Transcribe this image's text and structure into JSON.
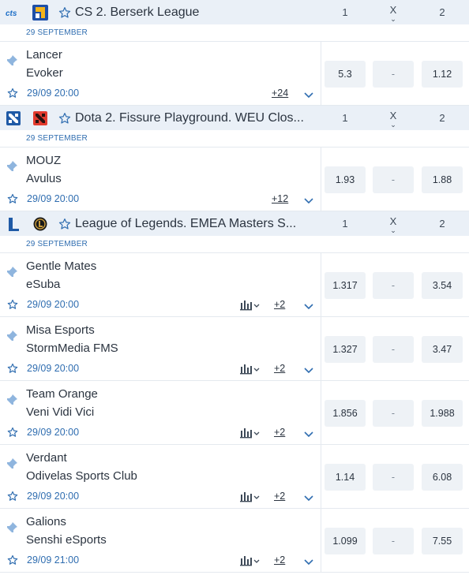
{
  "columns": {
    "home": "1",
    "draw": "X",
    "away": "2"
  },
  "colors": {
    "accent": "#2f6db0",
    "header_bg": "#eaf0f7",
    "odd_bg": "#eef2f6"
  },
  "leagues": [
    {
      "name": "CS 2. Berserk League",
      "sport_icon": "counter-strike-logo",
      "logo_icon": "berserk-league-logo",
      "date": "29 SEPTEMBER",
      "matches": [
        {
          "team1": "Lancer",
          "team2": "Evoker",
          "time": "29/09 20:00",
          "more": "+24",
          "odd1": "5.3",
          "oddx": "-",
          "odd2": "1.12"
        }
      ]
    },
    {
      "name": "Dota 2. Fissure Playground. WEU Clos...",
      "sport_icon": "dota2-logo",
      "logo_icon": "fissure-playground-logo",
      "date": "29 SEPTEMBER",
      "matches": [
        {
          "team1": "MOUZ",
          "team2": "Avulus",
          "time": "29/09 20:00",
          "more": "+12",
          "odd1": "1.93",
          "oddx": "-",
          "odd2": "1.88"
        }
      ]
    },
    {
      "name": "League of Legends. EMEA Masters S...",
      "sport_icon": "league-of-legends-logo",
      "logo_icon": "emea-masters-logo",
      "date": "29 SEPTEMBER",
      "matches": [
        {
          "team1": "Gentle Mates",
          "team2": "eSuba",
          "time": "29/09 20:00",
          "more": "+2",
          "odd1": "1.317",
          "oddx": "-",
          "odd2": "3.54"
        },
        {
          "team1": "Misa Esports",
          "team2": "StormMedia FMS",
          "time": "29/09 20:00",
          "more": "+2",
          "odd1": "1.327",
          "oddx": "-",
          "odd2": "3.47"
        },
        {
          "team1": "Team Orange",
          "team2": "Veni Vidi Vici",
          "time": "29/09 20:00",
          "more": "+2",
          "odd1": "1.856",
          "oddx": "-",
          "odd2": "1.988"
        },
        {
          "team1": "Verdant",
          "team2": "Odivelas Sports Club",
          "time": "29/09 20:00",
          "more": "+2",
          "odd1": "1.14",
          "oddx": "-",
          "odd2": "6.08"
        },
        {
          "team1": "Galions",
          "team2": "Senshi eSports",
          "time": "29/09 21:00",
          "more": "+2",
          "odd1": "1.099",
          "oddx": "-",
          "odd2": "7.55"
        }
      ]
    }
  ]
}
